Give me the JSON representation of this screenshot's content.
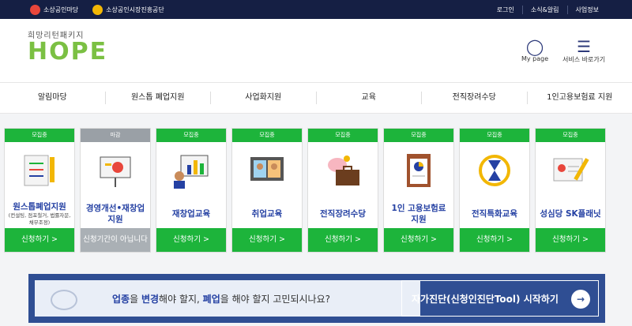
{
  "topbar": {
    "brand1": "소상공인마당",
    "brand2": "소상공인시장진흥공단",
    "links": [
      "로그인",
      "소식&알림",
      "사업정보"
    ]
  },
  "header": {
    "logo_sub": "희망리턴패키지",
    "logo_main": "HOPE",
    "mypage": "My page",
    "menu": "서비스 바로가기"
  },
  "nav": [
    "알림마당",
    "원스톱 폐업지원",
    "사업화지원",
    "교육",
    "전직장려수당",
    "1인고용보험료 지원"
  ],
  "cards": [
    {
      "status": "모집중",
      "title": "원스톱폐업지원",
      "sub": "(컨설팅, 점포철거, 법률자문, 채무조정)",
      "apply": "신청하기 >",
      "closed": false,
      "icon": "checklist-pencil-icon"
    },
    {
      "status": "마감",
      "title": "경영개선•재창업 지원",
      "sub": "",
      "apply": "신청기간이 아닙니다",
      "closed": true,
      "icon": "presentation-board-icon"
    },
    {
      "status": "모집중",
      "title": "재창업교육",
      "sub": "",
      "apply": "신청하기 >",
      "closed": false,
      "icon": "bar-chart-board-icon"
    },
    {
      "status": "모집중",
      "title": "취업교육",
      "sub": "",
      "apply": "신청하기 >",
      "closed": false,
      "icon": "video-meeting-icon"
    },
    {
      "status": "모집중",
      "title": "전직장려수당",
      "sub": "",
      "apply": "신청하기 >",
      "closed": false,
      "icon": "piggybank-briefcase-icon"
    },
    {
      "status": "모집중",
      "title": "1인 고용보험료 지원",
      "sub": "",
      "apply": "신청하기 >",
      "closed": false,
      "icon": "clipboard-chart-icon"
    },
    {
      "status": "모집중",
      "title": "전직특화교육",
      "sub": "",
      "apply": "신청하기 >",
      "closed": false,
      "icon": "hourglass-icon"
    },
    {
      "status": "모집중",
      "title": "성심당 SK플래닛",
      "sub": "",
      "apply": "신청하기 >",
      "closed": false,
      "icon": "id-card-pen-icon"
    }
  ],
  "banner": {
    "pre": "업종",
    "mid1": "을 ",
    "b2": "변경",
    "mid2": "해야 할지, ",
    "b3": "폐업",
    "post": "을 해야 할지 고민되시나요?",
    "cta": "자가진단(신청인진단Tool) 시작하기",
    "arrow": "→"
  }
}
